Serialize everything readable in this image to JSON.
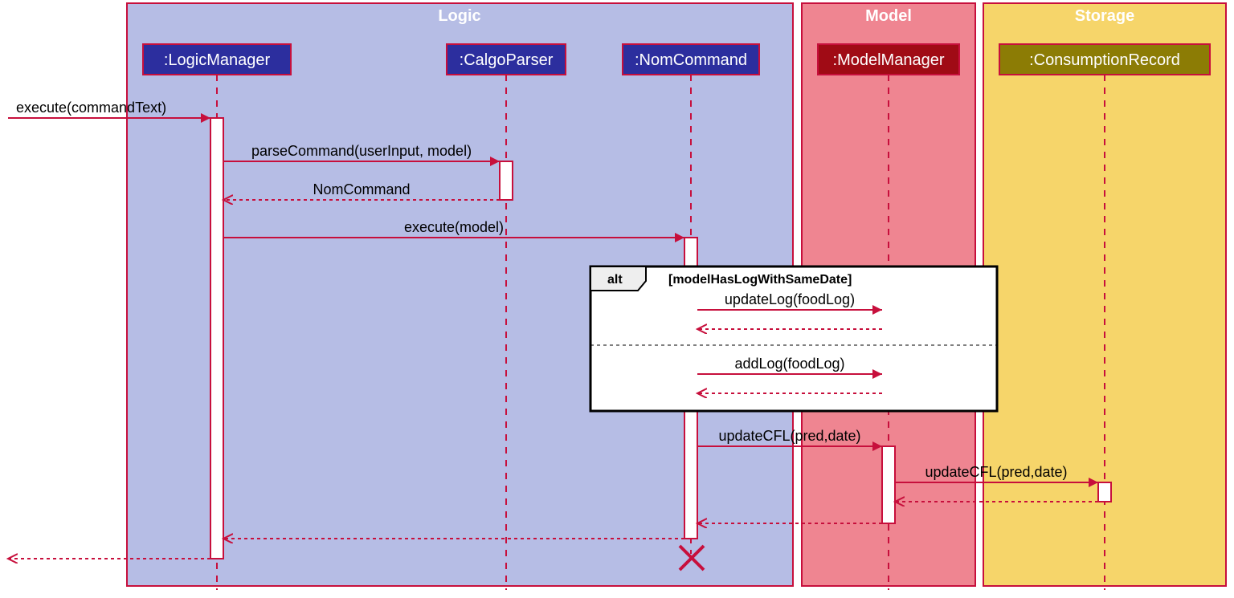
{
  "frames": {
    "logic": {
      "title": "Logic"
    },
    "model": {
      "title": "Model"
    },
    "storage": {
      "title": "Storage"
    }
  },
  "participants": {
    "logicManager": {
      "label": ":LogicManager"
    },
    "calgoParser": {
      "label": ":CalgoParser"
    },
    "nomCommand": {
      "label": ":NomCommand"
    },
    "modelManager": {
      "label": ":ModelManager"
    },
    "consumptionRecord": {
      "label": ":ConsumptionRecord"
    }
  },
  "altFragment": {
    "operator": "alt",
    "guard": "[modelHasLogWithSameDate]"
  },
  "messages": {
    "executeCmd": {
      "label": "execute(commandText)"
    },
    "parseCommand": {
      "label": "parseCommand(userInput, model)"
    },
    "retNom": {
      "label": "NomCommand"
    },
    "executeModel": {
      "label": "execute(model)"
    },
    "updateLog": {
      "label": "updateLog(foodLog)"
    },
    "addLog": {
      "label": "addLog(foodLog)"
    },
    "updateCFL1": {
      "label": "updateCFL(pred,date)"
    },
    "updateCFL2": {
      "label": "updateCFL(pred,date)"
    }
  },
  "colors": {
    "logicFrame": "#B6BDE5",
    "modelFrame": "#EF8591",
    "storageFrame": "#F6D56A",
    "frameBorder": "#C70F3C",
    "logicBox": "#2C2E9E",
    "modelBox": "#A00B15",
    "storageBox": "#8C7C05",
    "arrowRed": "#C70F3C",
    "altTab": "#EEEEEE"
  }
}
